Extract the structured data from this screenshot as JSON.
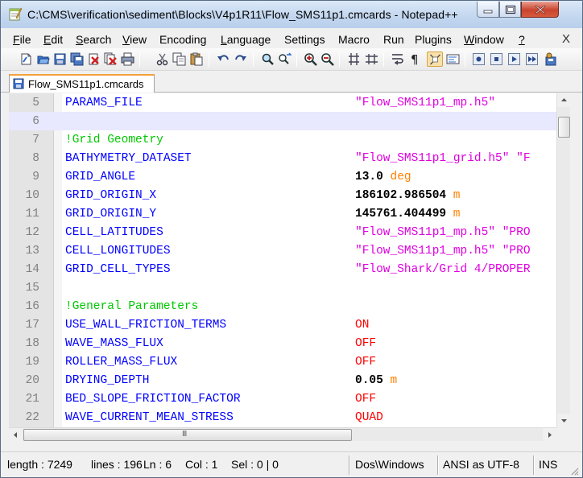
{
  "window": {
    "title": "C:\\CMS\\verification\\sediment\\Blocks\\V4p1R11\\Flow_SMS11p1.cmcards - Notepad++"
  },
  "menu": [
    {
      "label": "File",
      "key": "F",
      "rest": "ile"
    },
    {
      "label": "Edit",
      "key": "E",
      "rest": "dit"
    },
    {
      "label": "Search",
      "key": "S",
      "rest": "earch"
    },
    {
      "label": "View",
      "key": "V",
      "rest": "iew"
    },
    {
      "label": "Encoding",
      "key": "",
      "rest": "Encoding"
    },
    {
      "label": "Language",
      "key": "L",
      "rest": "anguage"
    },
    {
      "label": "Settings",
      "key": "",
      "rest": "Settings"
    },
    {
      "label": "Macro",
      "key": "",
      "rest": "Macro"
    },
    {
      "label": "Run",
      "key": "",
      "rest": "Run"
    },
    {
      "label": "Plugins",
      "key": "",
      "rest": "Plugins"
    },
    {
      "label": "Window",
      "key": "W",
      "rest": "indow"
    },
    {
      "label": "?",
      "key": "?",
      "rest": ""
    }
  ],
  "menu_close": "X",
  "tab": {
    "label": "Flow_SMS11p1.cmcards"
  },
  "lines": [
    {
      "num": "5",
      "text": "PARAMS_FILE",
      "kind": "key",
      "value": "\"Flow_SMS11p1_mp.h5\"",
      "vtype": "str",
      "unit": ""
    },
    {
      "num": "6",
      "text": "",
      "kind": "blank",
      "value": "",
      "vtype": "",
      "unit": "",
      "current": true
    },
    {
      "num": "7",
      "text": "!Grid Geometry",
      "kind": "comment",
      "value": "",
      "vtype": "",
      "unit": ""
    },
    {
      "num": "8",
      "text": "BATHYMETRY_DATASET",
      "kind": "key",
      "value": "\"Flow_SMS11p1_grid.h5\" \"F",
      "vtype": "str",
      "unit": ""
    },
    {
      "num": "9",
      "text": "GRID_ANGLE",
      "kind": "key",
      "value": "13.0",
      "vtype": "num",
      "unit": "deg"
    },
    {
      "num": "10",
      "text": "GRID_ORIGIN_X",
      "kind": "key",
      "value": "186102.986504",
      "vtype": "num",
      "unit": "m"
    },
    {
      "num": "11",
      "text": "GRID_ORIGIN_Y",
      "kind": "key",
      "value": "145761.404499",
      "vtype": "num",
      "unit": "m"
    },
    {
      "num": "12",
      "text": "CELL_LATITUDES",
      "kind": "key",
      "value": "\"Flow_SMS11p1_mp.h5\" \"PRO",
      "vtype": "str",
      "unit": ""
    },
    {
      "num": "13",
      "text": "CELL_LONGITUDES",
      "kind": "key",
      "value": "\"Flow_SMS11p1_mp.h5\" \"PRO",
      "vtype": "str",
      "unit": ""
    },
    {
      "num": "14",
      "text": "GRID_CELL_TYPES",
      "kind": "key",
      "value": "\"Flow_Shark/Grid 4/PROPER",
      "vtype": "str",
      "unit": ""
    },
    {
      "num": "15",
      "text": "",
      "kind": "blank",
      "value": "",
      "vtype": "",
      "unit": ""
    },
    {
      "num": "16",
      "text": "!General Parameters",
      "kind": "comment",
      "value": "",
      "vtype": "",
      "unit": ""
    },
    {
      "num": "17",
      "text": "USE_WALL_FRICTION_TERMS",
      "kind": "key",
      "value": "ON",
      "vtype": "kw",
      "unit": ""
    },
    {
      "num": "18",
      "text": "WAVE_MASS_FLUX",
      "kind": "key",
      "value": "OFF",
      "vtype": "kw",
      "unit": ""
    },
    {
      "num": "19",
      "text": "ROLLER_MASS_FLUX",
      "kind": "key",
      "value": "OFF",
      "vtype": "kw",
      "unit": ""
    },
    {
      "num": "20",
      "text": "DRYING_DEPTH",
      "kind": "key",
      "value": "0.05",
      "vtype": "num",
      "unit": "m"
    },
    {
      "num": "21",
      "text": "BED_SLOPE_FRICTION_FACTOR",
      "kind": "key",
      "value": "OFF",
      "vtype": "kw",
      "unit": ""
    },
    {
      "num": "22",
      "text": "WAVE_CURRENT_MEAN_STRESS",
      "kind": "key",
      "value": "QUAD",
      "vtype": "kw",
      "unit": ""
    }
  ],
  "scroll_grip": "III",
  "status": {
    "length": "length : 7249",
    "lines": "lines : 196",
    "ln": "Ln : 6",
    "col": "Col : 1",
    "sel": "Sel : 0 | 0",
    "eol": "Dos\\Windows",
    "encoding": "ANSI as UTF-8",
    "mode": "INS"
  },
  "colors": {
    "keyword": "#0000ff",
    "comment": "#00c800",
    "string": "#e000e0",
    "unit": "#ff8000",
    "constant": "#ff0000",
    "current_line": "#e8e8ff"
  }
}
